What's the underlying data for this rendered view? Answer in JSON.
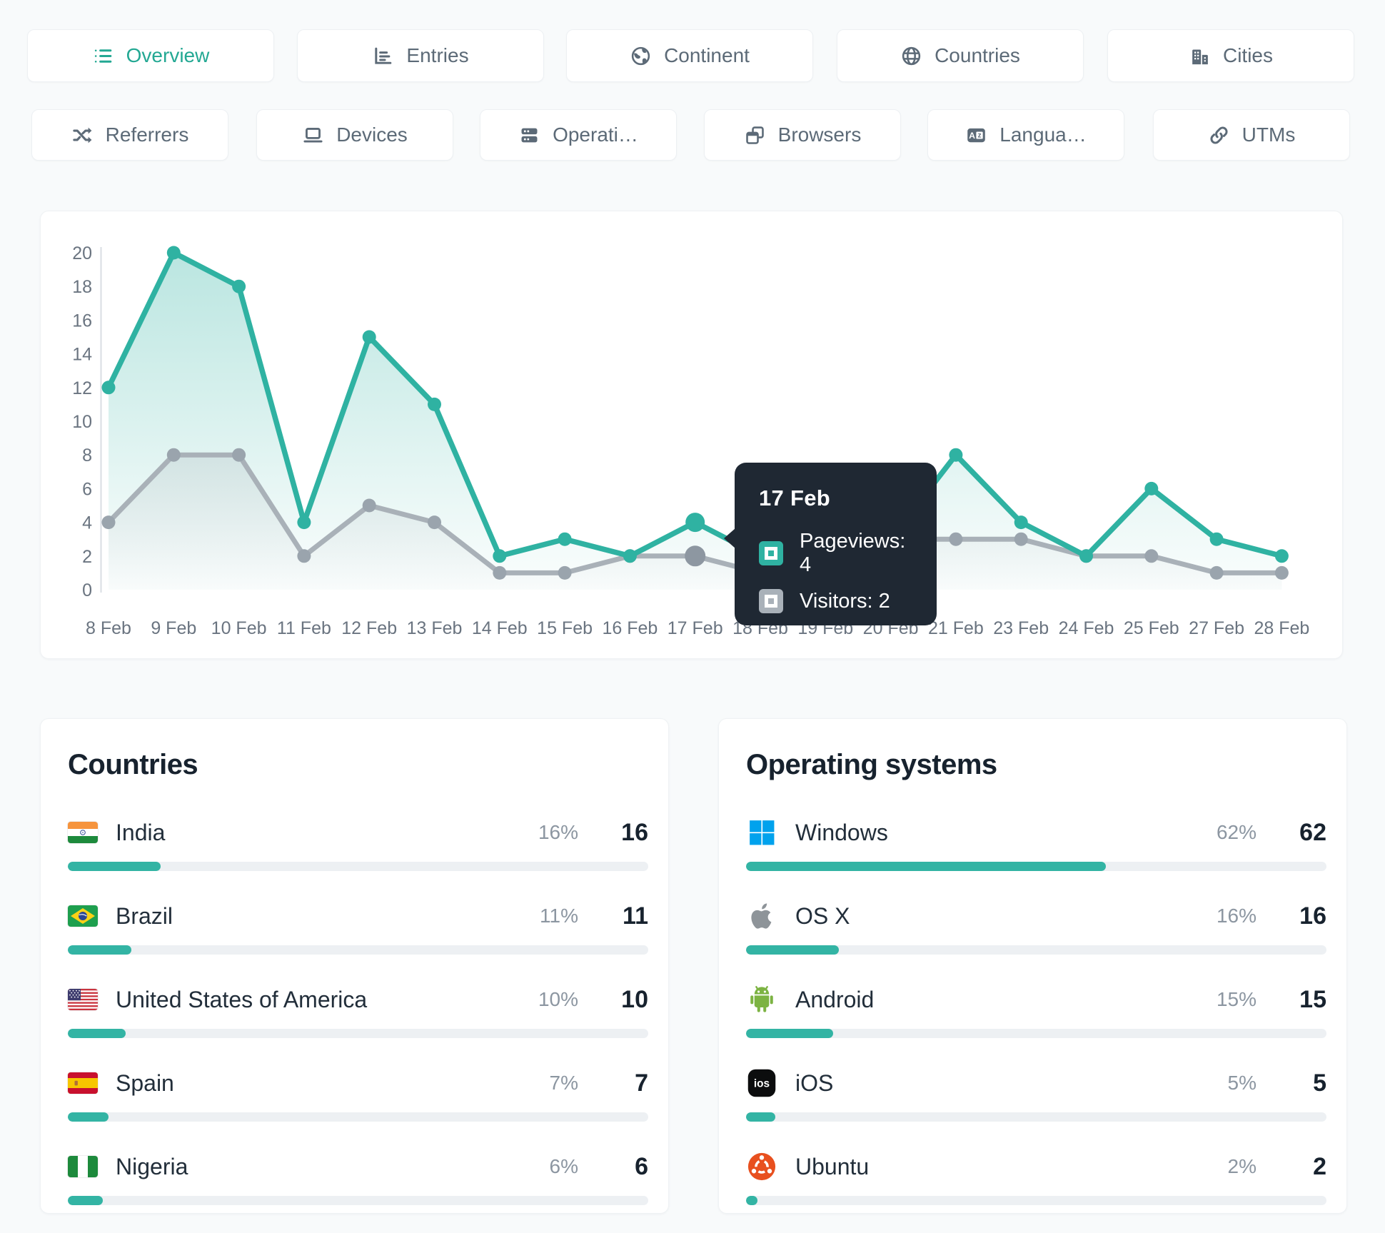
{
  "colors": {
    "accent": "#2fb2a2",
    "accent_text": "#23a893",
    "visitors_line": "#a9b1b8",
    "visitors_dot": "#9aa4ad",
    "highlight_dot": "#8d97a1",
    "tooltip_bg": "#1f2833",
    "tooltip_gray_square": "#a9b1b9",
    "axis_text": "#6a7480",
    "axis_line": "#d9dee3",
    "bar_track": "#edf0f3",
    "bar_fill": "#33b4a4"
  },
  "tabs_row1": [
    {
      "label": "Overview",
      "icon": "list-icon",
      "active": true
    },
    {
      "label": "Entries",
      "icon": "entries-chart-icon",
      "active": false
    },
    {
      "label": "Continent",
      "icon": "continent-globe-icon",
      "active": false
    },
    {
      "label": "Countries",
      "icon": "countries-globe-icon",
      "active": false
    },
    {
      "label": "Cities",
      "icon": "cities-building-icon",
      "active": false
    }
  ],
  "tabs_row2": [
    {
      "label": "Referrers",
      "icon": "shuffle-icon",
      "active": false
    },
    {
      "label": "Devices",
      "icon": "laptop-icon",
      "active": false
    },
    {
      "label": "Operati…",
      "icon": "server-icon",
      "active": false
    },
    {
      "label": "Browsers",
      "icon": "browser-windows-icon",
      "active": false
    },
    {
      "label": "Langua…",
      "icon": "translate-icon",
      "active": false
    },
    {
      "label": "UTMs",
      "icon": "link-icon",
      "active": false
    }
  ],
  "chart_data": {
    "type": "line",
    "x": [
      "8 Feb",
      "9 Feb",
      "10 Feb",
      "11 Feb",
      "12 Feb",
      "13 Feb",
      "14 Feb",
      "15 Feb",
      "16 Feb",
      "17 Feb",
      "18 Feb",
      "19 Feb",
      "20 Feb",
      "21 Feb",
      "23 Feb",
      "24 Feb",
      "25 Feb",
      "27 Feb",
      "28 Feb"
    ],
    "series": [
      {
        "name": "Pageviews",
        "color": "#2fb2a2",
        "values": [
          12,
          20,
          18,
          4,
          15,
          11,
          2,
          3,
          2,
          4,
          2,
          1,
          3,
          8,
          4,
          2,
          6,
          3,
          2
        ]
      },
      {
        "name": "Visitors",
        "color": "#a9b1b8",
        "values": [
          4,
          8,
          8,
          2,
          5,
          4,
          1,
          1,
          2,
          2,
          1,
          1,
          3,
          3,
          3,
          2,
          2,
          1,
          1
        ]
      }
    ],
    "ylim": [
      0,
      20
    ],
    "yticks": [
      0,
      2,
      4,
      6,
      8,
      10,
      12,
      14,
      16,
      18,
      20
    ],
    "grid": "off",
    "legend": "none"
  },
  "tooltip": {
    "title": "17 Feb",
    "rows": [
      {
        "name": "Pageviews",
        "value": 4,
        "square": "teal"
      },
      {
        "name": "Visitors",
        "value": 2,
        "square": "gray"
      }
    ]
  },
  "countries_panel": {
    "title": "Countries",
    "rows": [
      {
        "label": "India",
        "flag": "in",
        "percent": "16%",
        "count": "16"
      },
      {
        "label": "Brazil",
        "flag": "br",
        "percent": "11%",
        "count": "11"
      },
      {
        "label": "United States of America",
        "flag": "us",
        "percent": "10%",
        "count": "10"
      },
      {
        "label": "Spain",
        "flag": "es",
        "percent": "7%",
        "count": "7"
      },
      {
        "label": "Nigeria",
        "flag": "ng",
        "percent": "6%",
        "count": "6"
      }
    ]
  },
  "os_panel": {
    "title": "Operating systems",
    "rows": [
      {
        "label": "Windows",
        "icon": "windows-logo-icon",
        "percent": "62%",
        "count": "62"
      },
      {
        "label": "OS X",
        "icon": "apple-logo-icon",
        "percent": "16%",
        "count": "16"
      },
      {
        "label": "Android",
        "icon": "android-logo-icon",
        "percent": "15%",
        "count": "15"
      },
      {
        "label": "iOS",
        "icon": "ios-logo-icon",
        "percent": "5%",
        "count": "5"
      },
      {
        "label": "Ubuntu",
        "icon": "ubuntu-logo-icon",
        "percent": "2%",
        "count": "2"
      }
    ]
  }
}
